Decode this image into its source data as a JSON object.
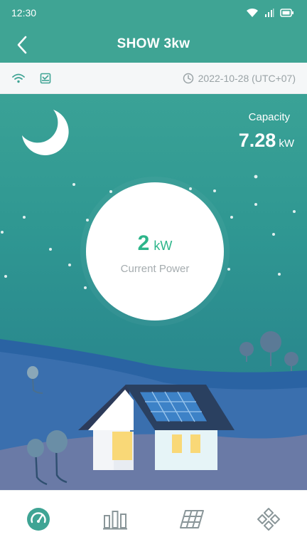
{
  "status_bar": {
    "time": "12:30",
    "icons": [
      "wifi-icon",
      "signal-icon",
      "battery-icon"
    ]
  },
  "header": {
    "title": "SHOW 3kw",
    "back_icon": "chevron-left-icon"
  },
  "info_bar": {
    "icons": [
      "wifi-icon",
      "inbox-icon"
    ],
    "timestamp": "2022-10-28 (UTC+07)",
    "clock_icon": "clock-icon"
  },
  "capacity": {
    "label": "Capacity",
    "value": "7.28",
    "unit": "kW"
  },
  "current_power": {
    "value": "2",
    "unit": "kW",
    "label": "Current Power"
  },
  "scene": {
    "time_of_day": "night",
    "icons": [
      "moon-icon",
      "house-icon",
      "solar-panel-icon",
      "tree-icon"
    ]
  },
  "bottom_nav": {
    "items": [
      {
        "icon": "gauge-icon",
        "active": true
      },
      {
        "icon": "bar-chart-icon",
        "active": false
      },
      {
        "icon": "solar-grid-icon",
        "active": false
      },
      {
        "icon": "devices-icon",
        "active": false
      }
    ]
  },
  "colors": {
    "brand": "#3fa494",
    "power_green": "#2db58a",
    "nav_active": "#3fa494",
    "nav_inactive": "#8a9699"
  }
}
